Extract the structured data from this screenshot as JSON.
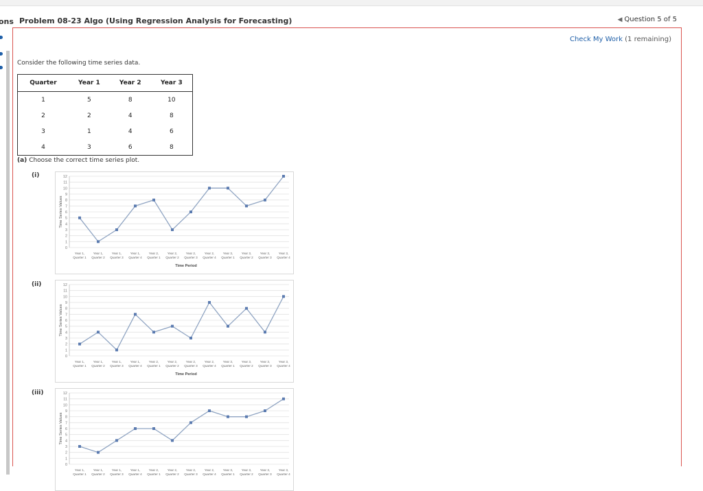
{
  "nav": {
    "partial_label": "ons"
  },
  "header": {
    "title": "Problem 08-23 Algo (Using Regression Analysis for Forecasting)",
    "question_nav": "Question 5 of 5"
  },
  "check_work": {
    "link": "Check My Work",
    "remaining": "(1 remaining)"
  },
  "intro": "Consider the following time series data.",
  "table": {
    "headers": [
      "Quarter",
      "Year 1",
      "Year 2",
      "Year 3"
    ],
    "rows": [
      [
        "1",
        "5",
        "8",
        "10"
      ],
      [
        "2",
        "2",
        "4",
        "8"
      ],
      [
        "3",
        "1",
        "4",
        "6"
      ],
      [
        "4",
        "3",
        "6",
        "8"
      ]
    ]
  },
  "part_a": {
    "label": "(a)",
    "text": "Choose the correct time series plot."
  },
  "option_labels": [
    "(i)",
    "(ii)",
    "(iii)"
  ],
  "colors": {
    "series": "#8fa4c2",
    "marker": "#5b7bb0",
    "accent_border": "#d9534f",
    "link": "#1f5fa8"
  },
  "chart_data": [
    {
      "type": "line",
      "ylabel": "Time Series Values",
      "xlabel": "Time Period",
      "ylim": [
        0,
        12
      ],
      "yticks": [
        "0",
        "1",
        "2",
        "3",
        "4",
        "5",
        "6",
        "7",
        "8",
        "9",
        "10",
        "11",
        "12"
      ],
      "categories": [
        [
          "Year 1,",
          "Quarter 1"
        ],
        [
          "Year 1,",
          "Quarter 2"
        ],
        [
          "Year 1,",
          "Quarter 3"
        ],
        [
          "Year 1,",
          "Quarter 4"
        ],
        [
          "Year 2,",
          "Quarter 1"
        ],
        [
          "Year 2,",
          "Quarter 2"
        ],
        [
          "Year 2,",
          "Quarter 3"
        ],
        [
          "Year 2,",
          "Quarter 4"
        ],
        [
          "Year 3,",
          "Quarter 1"
        ],
        [
          "Year 3,",
          "Quarter 2"
        ],
        [
          "Year 3,",
          "Quarter 3"
        ],
        [
          "Year 3,",
          "Quarter 4"
        ]
      ],
      "values": [
        5,
        1,
        3,
        7,
        8,
        3,
        6,
        10,
        10,
        7,
        8,
        12
      ],
      "grid": true
    },
    {
      "type": "line",
      "ylabel": "Time Series Values",
      "xlabel": "Time Period",
      "ylim": [
        0,
        12
      ],
      "yticks": [
        "0",
        "1",
        "2",
        "3",
        "4",
        "5",
        "6",
        "7",
        "8",
        "9",
        "10",
        "11",
        "12"
      ],
      "categories": [
        [
          "Year 1,",
          "Quarter 1"
        ],
        [
          "Year 1,",
          "Quarter 2"
        ],
        [
          "Year 1,",
          "Quarter 3"
        ],
        [
          "Year 1,",
          "Quarter 4"
        ],
        [
          "Year 2,",
          "Quarter 1"
        ],
        [
          "Year 2,",
          "Quarter 2"
        ],
        [
          "Year 2,",
          "Quarter 3"
        ],
        [
          "Year 2,",
          "Quarter 4"
        ],
        [
          "Year 3,",
          "Quarter 1"
        ],
        [
          "Year 3,",
          "Quarter 2"
        ],
        [
          "Year 3,",
          "Quarter 3"
        ],
        [
          "Year 3,",
          "Quarter 4"
        ]
      ],
      "values": [
        2,
        4,
        1,
        7,
        4,
        5,
        3,
        9,
        5,
        8,
        4,
        10
      ],
      "grid": true
    },
    {
      "type": "line",
      "ylabel": "Time Series Values",
      "xlabel": "",
      "ylim": [
        0,
        12
      ],
      "yticks": [
        "0",
        "1",
        "2",
        "3",
        "4",
        "5",
        "6",
        "7",
        "8",
        "9",
        "10",
        "11",
        "12"
      ],
      "categories": [
        [
          "Year 1,",
          "Quarter 1"
        ],
        [
          "Year 1,",
          "Quarter 2"
        ],
        [
          "Year 1,",
          "Quarter 3"
        ],
        [
          "Year 1,",
          "Quarter 4"
        ],
        [
          "Year 2,",
          "Quarter 1"
        ],
        [
          "Year 2,",
          "Quarter 2"
        ],
        [
          "Year 2,",
          "Quarter 3"
        ],
        [
          "Year 2,",
          "Quarter 4"
        ],
        [
          "Year 3,",
          "Quarter 1"
        ],
        [
          "Year 3,",
          "Quarter 2"
        ],
        [
          "Year 3,",
          "Quarter 3"
        ],
        [
          "Year 3,",
          "Quarter 4"
        ]
      ],
      "values": [
        3,
        2,
        4,
        6,
        6,
        4,
        7,
        9,
        8,
        8,
        9,
        11
      ],
      "grid": true
    }
  ]
}
